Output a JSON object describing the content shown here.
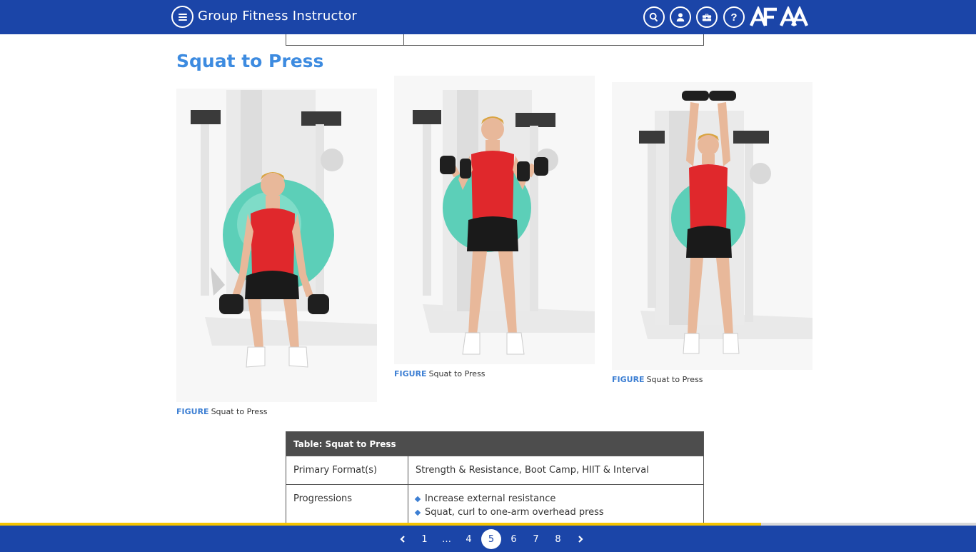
{
  "header": {
    "title": "Group Fitness Instructor",
    "brand": "AFAA",
    "icons": [
      "menu-icon",
      "search-icon",
      "user-icon",
      "toolbox-icon",
      "help-icon"
    ],
    "help_glyph": "?"
  },
  "section": {
    "title": "Squat to Press"
  },
  "figures": [
    {
      "label": "FIGURE",
      "caption": "Squat to Press",
      "pose": "squat"
    },
    {
      "label": "FIGURE",
      "caption": "Squat to Press",
      "pose": "curl"
    },
    {
      "label": "FIGURE",
      "caption": "Squat to Press",
      "pose": "press"
    }
  ],
  "table": {
    "title": "Table: Squat to Press",
    "rows": [
      {
        "label": "Primary Format(s)",
        "value": "Strength & Resistance, Boot Camp, HIIT & Interval"
      },
      {
        "label": "Progressions",
        "items": [
          "Increase external resistance",
          "Squat, curl to one-arm overhead press"
        ]
      }
    ]
  },
  "footer": {
    "pages": [
      "1",
      "…",
      "4",
      "5",
      "6",
      "7",
      "8"
    ],
    "current_page": "5",
    "progress_fraction": 0.78
  },
  "colors": {
    "header_bg": "#1b45a8",
    "title_blue": "#3d8be0",
    "caption_label": "#3d7fd3",
    "table_head": "#4d4d4d",
    "progress": "#f5c400",
    "shirt_red": "#e0282c",
    "ball_teal": "#5ccfb8"
  }
}
